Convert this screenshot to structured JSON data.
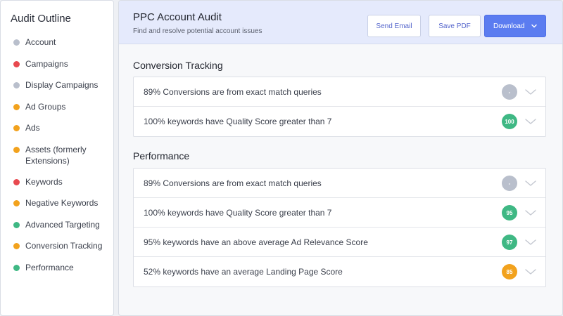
{
  "sidebar": {
    "title": "Audit Outline",
    "items": [
      {
        "label": "Account",
        "status": "neutral"
      },
      {
        "label": "Campaigns",
        "status": "error"
      },
      {
        "label": "Display Campaigns",
        "status": "neutral"
      },
      {
        "label": "Ad Groups",
        "status": "warning"
      },
      {
        "label": "Ads",
        "status": "warning"
      },
      {
        "label": "Assets (formerly Extensions)",
        "status": "warning"
      },
      {
        "label": "Keywords",
        "status": "error"
      },
      {
        "label": "Negative Keywords",
        "status": "warning"
      },
      {
        "label": "Advanced Targeting",
        "status": "success"
      },
      {
        "label": "Conversion Tracking",
        "status": "warning"
      },
      {
        "label": "Performance",
        "status": "success"
      }
    ]
  },
  "header": {
    "title": "PPC Account Audit",
    "subtitle": "Find and resolve potential account issues",
    "send_email_label": "Send Email",
    "save_pdf_label": "Save PDF",
    "download_label": "Download"
  },
  "sections": [
    {
      "title": "Conversion Tracking",
      "rows": [
        {
          "text": "89% Conversions are from exact match queries",
          "score": "-",
          "status": "neutral"
        },
        {
          "text": "100% keywords have Quality Score greater than 7",
          "score": "100",
          "status": "success"
        }
      ]
    },
    {
      "title": "Performance",
      "rows": [
        {
          "text": "89% Conversions are from exact match queries",
          "score": "-",
          "status": "neutral"
        },
        {
          "text": "100% keywords have Quality Score greater than 7",
          "score": "95",
          "status": "success"
        },
        {
          "text": "95% keywords have an above average Ad Relevance Score",
          "score": "97",
          "status": "success"
        },
        {
          "text": "52% keywords have an average Landing Page Score",
          "score": "85",
          "status": "warning"
        }
      ]
    }
  ],
  "colors": {
    "neutral": "#b9bfcc",
    "error": "#e8494f",
    "warning": "#f2a21d",
    "success": "#3fb884",
    "accent": "#5b7cf0"
  }
}
